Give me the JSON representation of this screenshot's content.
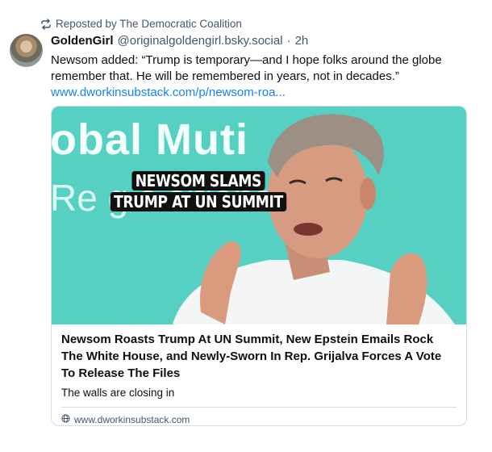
{
  "repost": {
    "label": "Reposted by The Democratic Coalition"
  },
  "post": {
    "display_name": "GoldenGirl",
    "handle": "@originalgoldengirl.bsky.social",
    "separator": "·",
    "time": "2h",
    "text": "Newsom added: “Trump is temporary—and I hope folks around the globe remember that. He will be remembered in years, not in decades.”",
    "link_text": "www.dworkinsubstack.com/p/newsom-roa..."
  },
  "card": {
    "image_caption_line1": "NEWSOM SLAMS",
    "image_caption_line2": "TRUMP AT UN SUMMIT",
    "image_bg_text1": "obal Muti",
    "image_bg_text2": "Re        g   s   sitions",
    "title": "Newsom Roasts Trump At UN Summit, New Epstein Emails Rock The White House, and Newly-Sworn In Rep. Grijalva Forces A Vote To Release The Files",
    "description": "The walls are closing in",
    "domain": "www.dworkinsubstack.com"
  },
  "icons": {
    "repost": "repost-icon",
    "globe": "globe-icon"
  },
  "colors": {
    "link": "#1083fe",
    "muted": "#42576c",
    "image_bg": "#55d0c2"
  }
}
